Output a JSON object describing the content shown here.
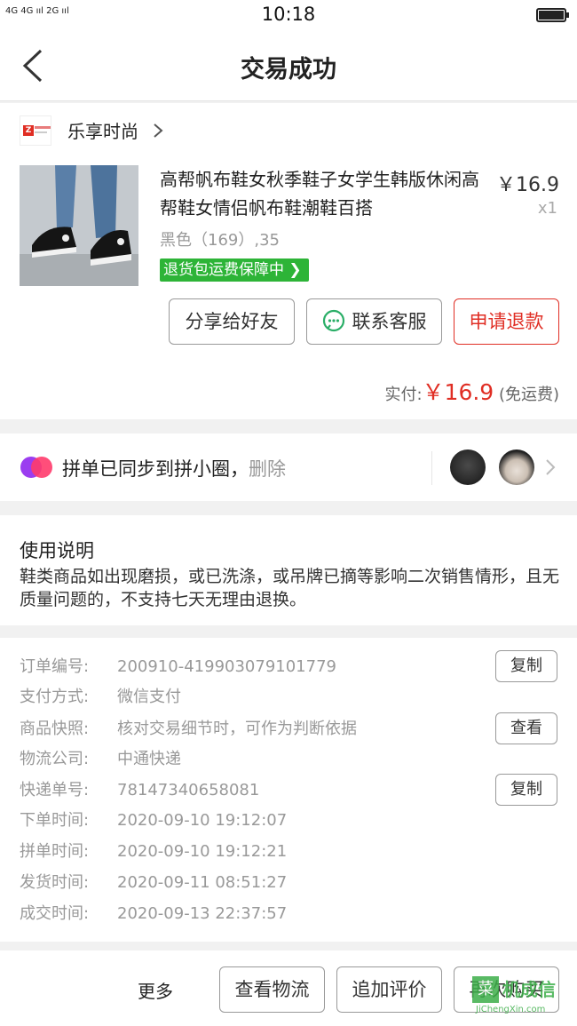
{
  "status_bar": {
    "signal": "4G 4G ııl  2G ııl",
    "time": "10:18"
  },
  "nav": {
    "title": "交易成功"
  },
  "shop": {
    "name": "乐享时尚",
    "logo_text": "Z"
  },
  "product": {
    "title": "高帮帆布鞋女秋季鞋子女学生韩版休闲高帮鞋女情侣帆布鞋潮鞋百搭",
    "price": "￥16.9",
    "qty": "x1",
    "spec": "黑色（169）,35",
    "guarantee": "退货包运费保障中"
  },
  "actions": {
    "share": "分享给好友",
    "service": "联系客服",
    "refund": "申请退款"
  },
  "payment": {
    "label": "实付:",
    "amount": "￥16.9",
    "note": "(免运费)"
  },
  "pin": {
    "text": "拼单已同步到拼小圈，",
    "delete": "删除"
  },
  "usage": {
    "title": "使用说明",
    "body": "鞋类商品如出现磨损，或已洗涤，或吊牌已摘等影响二次销售情形，且无质量问题的，不支持七天无理由退换。"
  },
  "info": {
    "rows": [
      {
        "label": "订单编号:",
        "value": "200910-419903079101779"
      },
      {
        "label": "支付方式:",
        "value": "微信支付"
      },
      {
        "label": "商品快照:",
        "value": "核对交易细节时，可作为判断依据"
      },
      {
        "label": "物流公司:",
        "value": "中通快递"
      },
      {
        "label": "快递单号:",
        "value": "78147340658081"
      },
      {
        "label": "下单时间:",
        "value": "2020-09-10 19:12:07"
      },
      {
        "label": "拼单时间:",
        "value": "2020-09-10 19:12:21"
      },
      {
        "label": "发货时间:",
        "value": "2020-09-11 08:51:27"
      },
      {
        "label": "成交时间:",
        "value": "2020-09-13 22:37:57"
      }
    ],
    "copy_label": "复制",
    "view_label": "查看"
  },
  "bottom": {
    "more": "更多",
    "logistics": "查看物流",
    "review": "追加评价",
    "rebuy": "再次购买"
  },
  "watermark": {
    "icon": "菜",
    "text": "机成信",
    "sub": "JiChengXin.com"
  },
  "colors": {
    "accent_red": "#e02e24",
    "guarantee_green": "#2db437",
    "wechat_green": "#2aae67"
  }
}
